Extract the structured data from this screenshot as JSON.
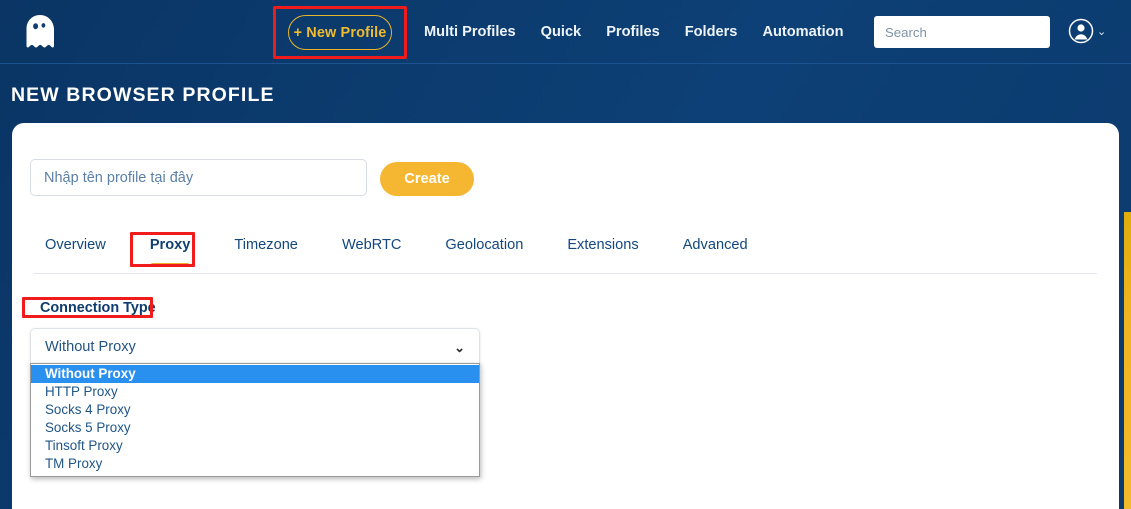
{
  "header": {
    "logo_icon": "ghost-logo-icon",
    "new_profile_button": "+ New Profile",
    "nav_items": [
      {
        "label": "Multi Profiles"
      },
      {
        "label": "Quick"
      },
      {
        "label": "Profiles"
      },
      {
        "label": "Folders"
      },
      {
        "label": "Automation"
      }
    ],
    "search": {
      "placeholder": "Search",
      "value": ""
    },
    "avatar_icon": "user-avatar-icon",
    "avatar_chevron": "⌄"
  },
  "page_title": "NEW BROWSER PROFILE",
  "profile_form": {
    "name_placeholder": "Nhập tên profile tại đây",
    "name_value": "",
    "create_label": "Create"
  },
  "tabs": [
    {
      "label": "Overview",
      "active": false
    },
    {
      "label": "Proxy",
      "active": true
    },
    {
      "label": "Timezone",
      "active": false
    },
    {
      "label": "WebRTC",
      "active": false
    },
    {
      "label": "Geolocation",
      "active": false
    },
    {
      "label": "Extensions",
      "active": false
    },
    {
      "label": "Advanced",
      "active": false
    }
  ],
  "proxy_panel": {
    "connection_type_label": "Connection Type",
    "selected_value": "Without Proxy",
    "chevron_icon": "⌄",
    "options": [
      {
        "label": "Without Proxy",
        "selected": true
      },
      {
        "label": "HTTP Proxy",
        "selected": false
      },
      {
        "label": "Socks 4 Proxy",
        "selected": false
      },
      {
        "label": "Socks 5 Proxy",
        "selected": false
      },
      {
        "label": "Tinsoft Proxy",
        "selected": false
      },
      {
        "label": "TM Proxy",
        "selected": false
      }
    ]
  },
  "colors": {
    "header_blue": "#0c3c70",
    "accent_yellow": "#f5b731",
    "annotation_red": "#f01c1c",
    "highlight_blue": "#2a90f0",
    "text_blue": "#1f5587"
  }
}
